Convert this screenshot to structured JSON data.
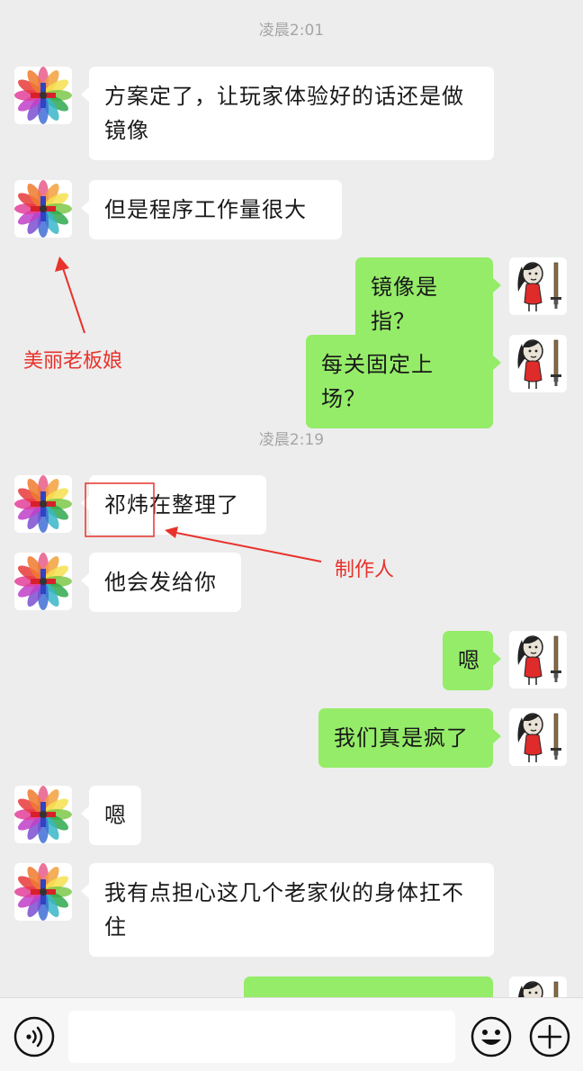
{
  "timestamps": [
    "凌晨2:01",
    "凌晨2:19"
  ],
  "messages": [
    {
      "side": "left",
      "text": "方案定了，让玩家体验好的话还是做镜像"
    },
    {
      "side": "left",
      "text": "但是程序工作量很大"
    },
    {
      "side": "right",
      "text": "镜像是指？"
    },
    {
      "side": "right",
      "text": "每关固定上场？"
    },
    {
      "side": "left",
      "text": "祁炜在整理了"
    },
    {
      "side": "left",
      "text": "他会发给你"
    },
    {
      "side": "right",
      "text": "嗯"
    },
    {
      "side": "right",
      "text": "我们真是疯了"
    },
    {
      "side": "left",
      "text": "嗯"
    },
    {
      "side": "left",
      "text": "我有点担心这几个老家伙的身体扛不住"
    },
    {
      "side": "right",
      "text": ""
    }
  ],
  "annotations": {
    "boss_label": "美丽老板娘",
    "producer_label": "制作人"
  },
  "icons": {
    "left_avatar": "color-flower-avatar",
    "right_avatar": "cartoon-girl-sword-avatar",
    "voice": "voice-icon",
    "emoji": "emoji-icon",
    "more": "plus-icon"
  },
  "colors": {
    "background": "#ededed",
    "bubble_self": "#95ec69",
    "bubble_other": "#ffffff",
    "annotation": "#e8322b"
  }
}
